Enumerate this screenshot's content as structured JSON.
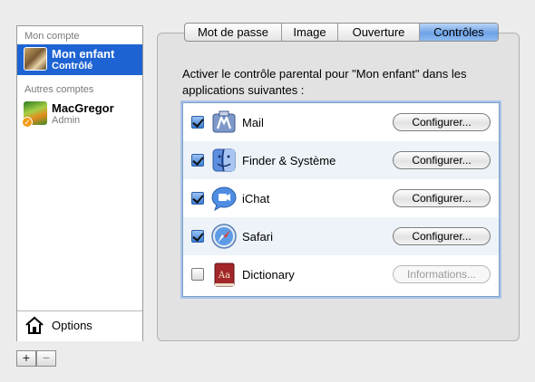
{
  "sidebar": {
    "section_mine": "Mon compte",
    "section_others": "Autres comptes",
    "account_mine": {
      "name": "Mon enfant",
      "role": "Contrôlé"
    },
    "account_other": {
      "name": "MacGregor",
      "role": "Admin"
    },
    "options_label": "Options",
    "add_label": "+",
    "remove_label": "−"
  },
  "tabs": [
    "Mot de passe",
    "Image",
    "Ouverture",
    "Contrôles"
  ],
  "active_tab": "Contrôles",
  "description": "Activer le contrôle parental pour \"Mon enfant\" dans les applications suivantes :",
  "apps": [
    {
      "name": "Mail",
      "checked": true,
      "button": "Configurer...",
      "icon": "mail-icon"
    },
    {
      "name": "Finder & Système",
      "checked": true,
      "button": "Configurer...",
      "icon": "finder-icon"
    },
    {
      "name": "iChat",
      "checked": true,
      "button": "Configurer...",
      "icon": "ichat-icon"
    },
    {
      "name": "Safari",
      "checked": true,
      "button": "Configurer...",
      "icon": "safari-icon"
    },
    {
      "name": "Dictionary",
      "checked": false,
      "button": "Informations...",
      "icon": "dictionary-icon"
    }
  ],
  "colors": {
    "selection": "#1d63d3",
    "active_tab": "#6ea3e8"
  }
}
